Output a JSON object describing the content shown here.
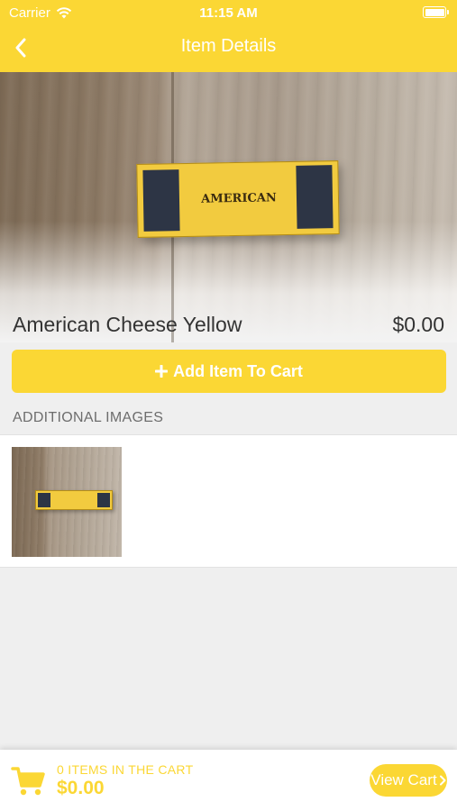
{
  "status_bar": {
    "carrier": "Carrier",
    "time": "11:15 AM",
    "battery_level": 1.0
  },
  "nav": {
    "title": "Item Details",
    "back_icon": "chevron-left-icon"
  },
  "product": {
    "name": "American Cheese Yellow",
    "price": "$0.00",
    "box_label": "AMERICAN"
  },
  "add_button": {
    "icon": "plus-icon",
    "label": "Add Item To Cart"
  },
  "additional_images": {
    "header": "ADDITIONAL IMAGES",
    "count": 1
  },
  "footer": {
    "cart_icon": "cart-icon",
    "items_text": "0 ITEMS IN THE CART",
    "total": "$0.00",
    "view_cart_label": "View Cart",
    "view_cart_icon": "chevron-right-icon"
  },
  "colors": {
    "accent": "#fbd734",
    "background": "#efefef",
    "text": "#333333",
    "section_header": "#6d6d6d"
  }
}
